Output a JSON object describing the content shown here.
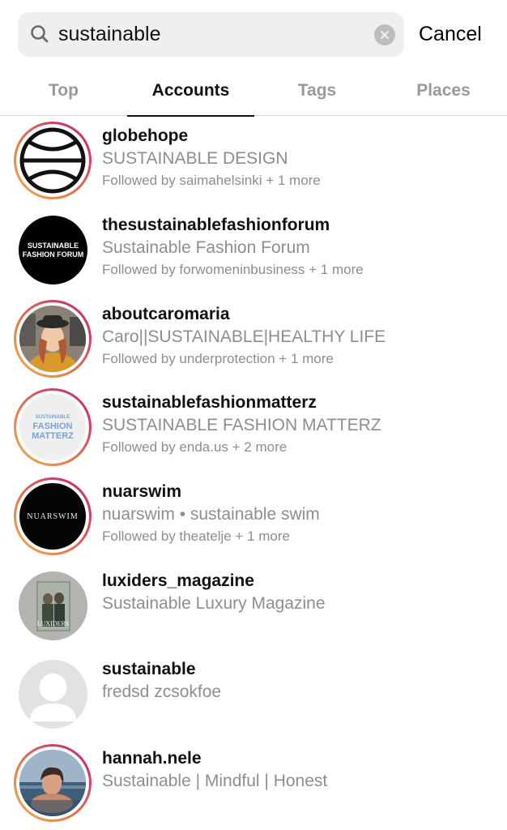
{
  "search": {
    "query": "sustainable",
    "cancel_label": "Cancel",
    "icon": "search-icon",
    "clear_icon": "clear-icon"
  },
  "tabs": [
    {
      "label": "Top",
      "active": false
    },
    {
      "label": "Accounts",
      "active": true
    },
    {
      "label": "Tags",
      "active": false
    },
    {
      "label": "Places",
      "active": false
    }
  ],
  "results": [
    {
      "username": "globehope",
      "full_name": "SUSTAINABLE DESIGN",
      "followed_by": "Followed by saimahelsinki + 1 more",
      "has_story": true
    },
    {
      "username": "thesustainablefashionforum",
      "full_name": "Sustainable Fashion Forum",
      "followed_by": "Followed by forwomeninbusiness + 1 more",
      "has_story": false,
      "avatar_text": [
        "SUSTAINABLE",
        "FASHION FORUM"
      ]
    },
    {
      "username": "aboutcaromaria",
      "full_name": "Caro||SUSTAINABLE|HEALTHY LIFE",
      "followed_by": "Followed by underprotection + 1 more",
      "has_story": true
    },
    {
      "username": "sustainablefashionmatterz",
      "full_name": "SUSTAINABLE FASHION MATTERZ",
      "followed_by": "Followed by enda.us + 2 more",
      "has_story": true,
      "avatar_text": [
        "SUSTAINABLE",
        "FASHION",
        "MATTERZ"
      ]
    },
    {
      "username": "nuarswim",
      "full_name": "nuarswim • sustainable swim",
      "followed_by": "Followed by theatelje + 1 more",
      "has_story": true,
      "avatar_text": [
        "NUARSWIM"
      ]
    },
    {
      "username": "luxiders_magazine",
      "full_name": "Sustainable Luxury Magazine",
      "has_story": false,
      "avatar_text": [
        "LUXIDERS"
      ]
    },
    {
      "username": "sustainable",
      "full_name": "fredsd zcsokfoe",
      "has_story": false
    },
    {
      "username": "hannah.nele",
      "full_name": "Sustainable | Mindful | Honest",
      "has_story": true
    }
  ]
}
